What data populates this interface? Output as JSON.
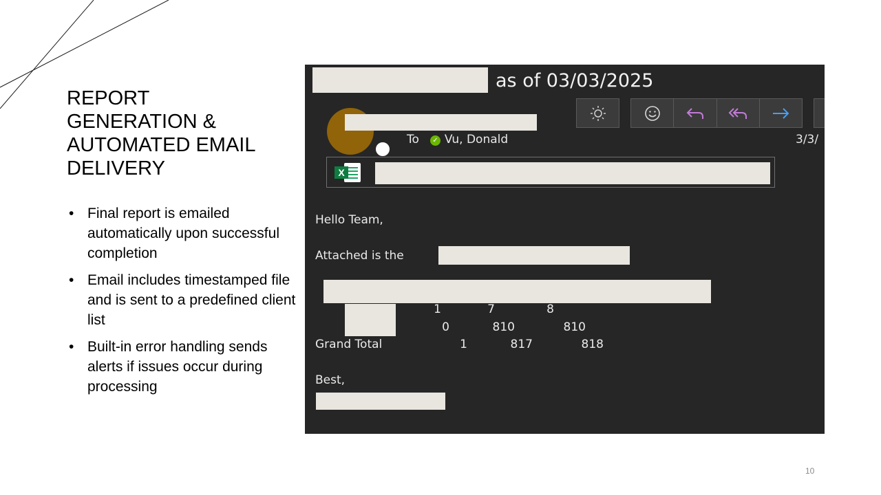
{
  "slide": {
    "title_lines": [
      "REPORT",
      "GENERATION &",
      "AUTOMATED EMAIL",
      "DELIVERY"
    ],
    "bullets": [
      "Final report is emailed automatically upon successful completion",
      "Email includes timestamped file and is sent to a predefined client list",
      "Built-in error handling sends alerts if issues occur during processing"
    ],
    "page_number": "10"
  },
  "email": {
    "subject_suffix": "as of 03/03/2025",
    "to_label": "To",
    "recipient": "Vu, Donald",
    "date_fragment": "3/3/",
    "greeting": "Hello Team,",
    "attached_text": "Attached is the",
    "table": {
      "row1": [
        "1",
        "7",
        "8"
      ],
      "row2": [
        "0",
        "810",
        "810"
      ],
      "total_label": "Grand Total",
      "total": [
        "1",
        "817",
        "818"
      ]
    },
    "signoff": "Best,",
    "toolbar_icons": [
      "brightness-icon",
      "emoji-icon",
      "reply-icon",
      "reply-all-icon",
      "forward-icon"
    ],
    "colors": {
      "background": "#262626",
      "avatar": "#916409",
      "reply_purple": "#c27bd9",
      "forward_blue": "#479ef5",
      "presence_green": "#6bb700",
      "excel_green": "#107c41"
    }
  }
}
